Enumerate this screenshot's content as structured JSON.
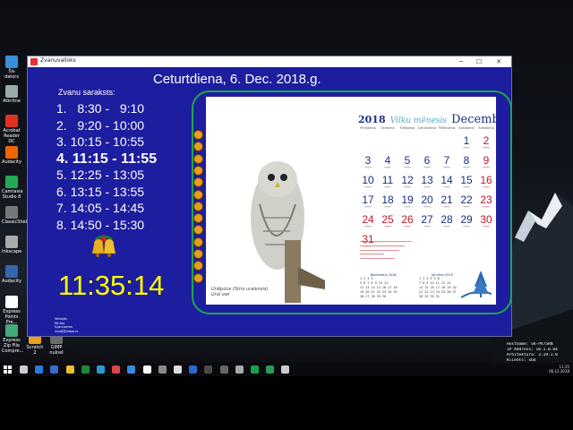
{
  "window": {
    "title": "Zvanuvalloks"
  },
  "date_text": "Ceturtdiena, 6. Dec. 2018.g.",
  "schedule": {
    "title": "Zvanu saraksts:",
    "rows": [
      "1.   8:30 -   9:10",
      "2.   9:20 - 10:00",
      "3. 10:15 - 10:55",
      "4. 11:15 - 11:55",
      "5. 12:25 - 13:05",
      "6. 13:15 - 13:55",
      "7. 14:05 - 14:45",
      "8. 14:50 - 15:30"
    ],
    "current_index": 3
  },
  "clock": "11:35:14",
  "footnote": [
    "Veidojis:",
    "Mr.Sky",
    "V.Jaunzems",
    "vvsdj@inbox.lv"
  ],
  "calendar": {
    "year": "2018",
    "month_lv": "Vilku mēnesis",
    "month": "Decembris",
    "weekdays": [
      "Pirmdiena",
      "Otrdiena",
      "Trešdiena",
      "Ceturtdiena",
      "Piektdiena",
      "Sestdiena",
      "Svētdiena"
    ],
    "weeks": [
      [
        {
          "d": ""
        },
        {
          "d": ""
        },
        {
          "d": ""
        },
        {
          "d": ""
        },
        {
          "d": ""
        },
        {
          "d": "1"
        },
        {
          "d": "2",
          "red": true
        }
      ],
      [
        {
          "d": "3"
        },
        {
          "d": "4"
        },
        {
          "d": "5"
        },
        {
          "d": "6"
        },
        {
          "d": "7"
        },
        {
          "d": "8"
        },
        {
          "d": "9",
          "red": true
        }
      ],
      [
        {
          "d": "10"
        },
        {
          "d": "11"
        },
        {
          "d": "12"
        },
        {
          "d": "13"
        },
        {
          "d": "14"
        },
        {
          "d": "15"
        },
        {
          "d": "16",
          "red": true
        }
      ],
      [
        {
          "d": "17"
        },
        {
          "d": "18"
        },
        {
          "d": "19"
        },
        {
          "d": "20"
        },
        {
          "d": "21"
        },
        {
          "d": "22"
        },
        {
          "d": "23",
          "red": true
        }
      ],
      [
        {
          "d": "24",
          "red": true
        },
        {
          "d": "25",
          "red": true
        },
        {
          "d": "26",
          "red": true
        },
        {
          "d": "27"
        },
        {
          "d": "28"
        },
        {
          "d": "29"
        },
        {
          "d": "30",
          "red": true
        }
      ],
      [
        {
          "d": "31",
          "red": true
        },
        {
          "d": ""
        },
        {
          "d": ""
        },
        {
          "d": ""
        },
        {
          "d": ""
        },
        {
          "d": ""
        },
        {
          "d": ""
        }
      ]
    ],
    "caption": [
      "Urālpūce (Strix uralensis)",
      "Ural owl"
    ],
    "mini_months": [
      {
        "title": "Novembris 2018",
        "rows": [
          "1 2 3 4",
          "5 6 7 8 9 10 11",
          "12 13 14 15 16 17 18",
          "19 20 21 22 23 24 25",
          "26 27 28 29 30"
        ]
      },
      {
        "title": "Janvāris 2019",
        "rows": [
          "1 2 3 4 5 6",
          "7 8 9 10 11 12 13",
          "14 15 16 17 18 19 20",
          "21 22 23 24 25 26 27",
          "28 29 30 31"
        ]
      }
    ]
  },
  "desktop_icons": [
    {
      "label": "Šis dators",
      "color": "#3b8fd9"
    },
    {
      "label": "Atkritne",
      "color": "#9aa"
    },
    {
      "label": "Acrobat Reader DC",
      "color": "#d32"
    },
    {
      "label": "Audacity",
      "color": "#e60"
    },
    {
      "label": "Camtasia Studio 8",
      "color": "#2a5"
    },
    {
      "label": "ClassicShell",
      "color": "#777"
    },
    {
      "label": "Inkscape",
      "color": "#aaa"
    },
    {
      "label": "Audacity",
      "color": "#36a"
    },
    {
      "label": "Express Points Pre...",
      "color": "#fff"
    },
    {
      "label": "Express Zip File Compre...",
      "color": "#4a7"
    }
  ],
  "taskbar_items": [
    {
      "label": "Scratch 2"
    },
    {
      "label": "GIMP nulnel"
    }
  ],
  "host_info": [
    "Hostname: SK-PV75RN",
    "IP Address: 10.1.0.64",
    "Arhitektūra: 3.19.1.0",
    "Klients: x64",
    "Diska lielums: 101.9",
    "Lietot. vārds: skola"
  ],
  "tray": {
    "time": "11:35",
    "date": "06.12.2018"
  }
}
